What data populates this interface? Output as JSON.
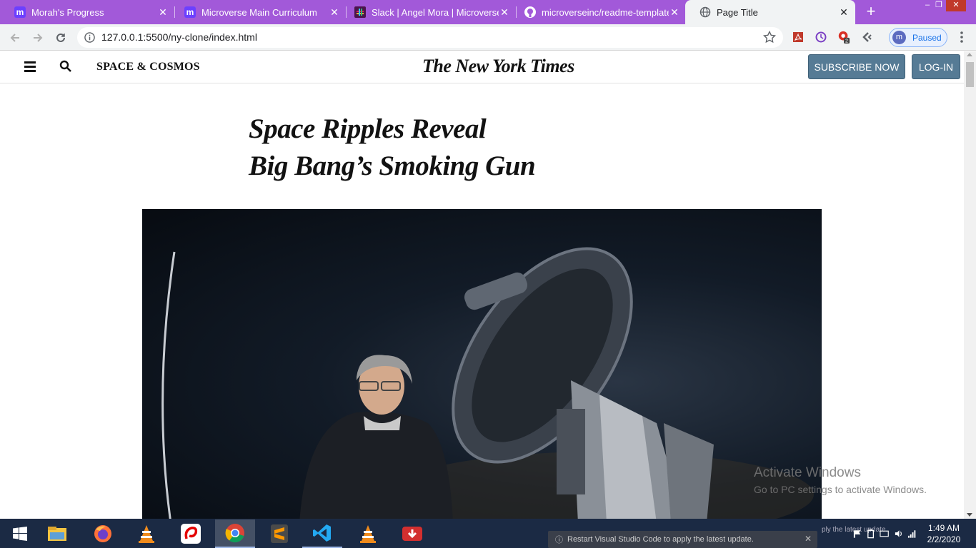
{
  "browser": {
    "tabs": [
      {
        "title": "Morah's Progress",
        "favicon": "m-logo",
        "active": false
      },
      {
        "title": "Microverse Main Curriculum",
        "favicon": "m-logo",
        "active": false
      },
      {
        "title": "Slack | Angel Mora | Microverse S",
        "favicon": "slack-logo",
        "active": false
      },
      {
        "title": "microverseinc/readme-template",
        "favicon": "github-logo",
        "active": false
      },
      {
        "title": "Page Title",
        "favicon": "globe-icon",
        "active": true
      }
    ],
    "url": "127.0.0.1:5500/ny-clone/index.html",
    "profile_initial": "m",
    "profile_status": "Paused",
    "extension_badge": "2"
  },
  "nyt": {
    "section": "SPACE & COSMOS",
    "logo": "The New York Times",
    "subscribe_label": "SUBSCRIBE NOW",
    "login_label": "LOG-IN",
    "headline_line1": "Space Ripples Reveal",
    "headline_line2": "Big Bang’s Smoking Gun",
    "hero_image": "person-standing-beside-telescope-at-night"
  },
  "watermark": {
    "title": "Activate Windows",
    "subtitle": "Go to PC settings to activate Windows."
  },
  "taskbar": {
    "notification": "Restart Visual Studio Code to apply the latest update.",
    "tray_text": "ply the latest update.",
    "time": "1:49 AM",
    "date": "2/2/2020"
  },
  "colors": {
    "tab_strip": "#a259d9",
    "nyt_button": "#567b95",
    "taskbar": "#1b2a44"
  }
}
